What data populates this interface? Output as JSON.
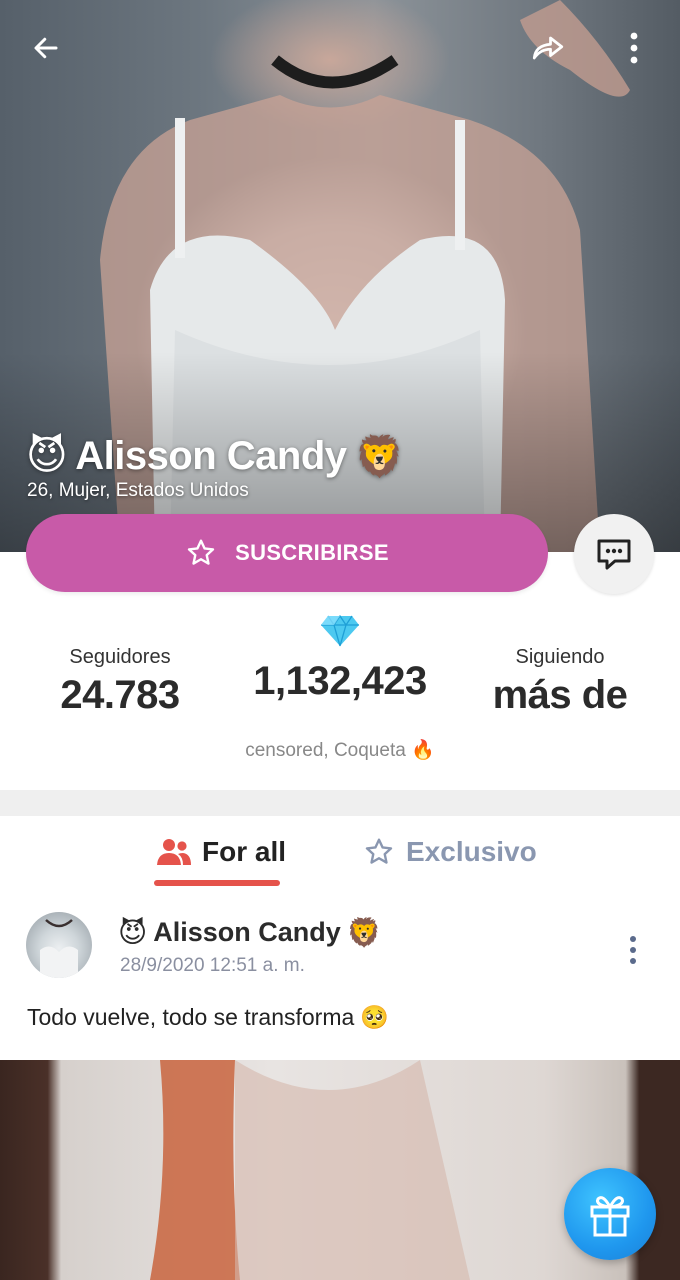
{
  "header": {
    "back_icon": "arrow-left-icon",
    "share_icon": "share-icon",
    "more_icon": "more-vertical-icon"
  },
  "profile": {
    "name": "Alisson Candy",
    "prefix_emoji": "😈",
    "suffix_emoji": "🦁",
    "info": "26, Mujer, Estados Unidos"
  },
  "actions": {
    "subscribe_label": "SUSCRIBIRSE",
    "subscribe_color": "#c85aa8",
    "chat_icon": "chat-bubble-icon"
  },
  "stats": {
    "followers_label": "Seguidores",
    "followers_value": "24.783",
    "diamonds_icon": "diamond-icon",
    "diamonds_value": "1,132,423",
    "following_label": "Siguiendo",
    "following_value": "más de"
  },
  "tags": {
    "text": "censored, Coqueta",
    "emoji": "🔥"
  },
  "tabs": [
    {
      "label": "For all",
      "icon": "users-icon",
      "active": true
    },
    {
      "label": "Exclusivo",
      "icon": "star-outline-icon",
      "active": false
    }
  ],
  "accent_color": "#e5534b",
  "post": {
    "author": "Alisson Candy",
    "prefix_emoji": "😈",
    "suffix_emoji": "🦁",
    "date": "28/9/2020 12:51 a. m.",
    "text": "Todo vuelve, todo se transforma",
    "text_emoji": "🥺"
  },
  "gift_icon": "gift-icon"
}
